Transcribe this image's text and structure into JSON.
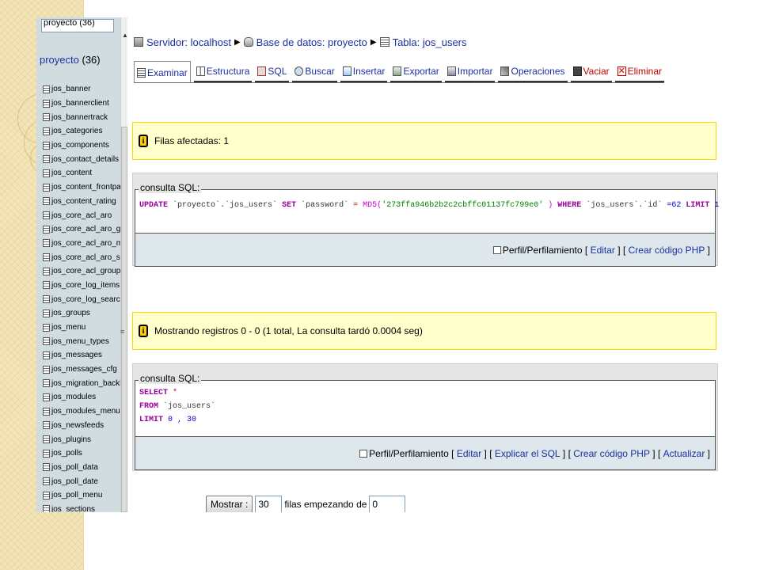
{
  "nav": {
    "db_select_text": "proyecto (36)",
    "db_title": {
      "name": "proyecto",
      "count": "(36)"
    },
    "tables": [
      "jos_banner",
      "jos_bannerclient",
      "jos_bannertrack",
      "jos_categories",
      "jos_components",
      "jos_contact_details",
      "jos_content",
      "jos_content_frontpage",
      "jos_content_rating",
      "jos_core_acl_aro",
      "jos_core_acl_aro_groups",
      "jos_core_acl_aro_map",
      "jos_core_acl_aro_sections",
      "jos_core_acl_groups_aro_m",
      "jos_core_log_items",
      "jos_core_log_searches",
      "jos_groups",
      "jos_menu",
      "jos_menu_types",
      "jos_messages",
      "jos_messages_cfg",
      "jos_migration_backlinks",
      "jos_modules",
      "jos_modules_menu",
      "jos_newsfeeds",
      "jos_plugins",
      "jos_polls",
      "jos_poll_data",
      "jos_poll_date",
      "jos_poll_menu",
      "jos_sections"
    ]
  },
  "breadcrumb": {
    "server": "Servidor: localhost",
    "database": "Base de datos: proyecto",
    "table": "Tabla: jos_users"
  },
  "tabs": [
    {
      "label": "Examinar",
      "icon": "browse-icon"
    },
    {
      "label": "Estructura",
      "icon": "structure-icon"
    },
    {
      "label": "SQL",
      "icon": "sql-icon"
    },
    {
      "label": "Buscar",
      "icon": "search-icon"
    },
    {
      "label": "Insertar",
      "icon": "insert-icon"
    },
    {
      "label": "Exportar",
      "icon": "export-icon"
    },
    {
      "label": "Importar",
      "icon": "import-icon"
    },
    {
      "label": "Operaciones",
      "icon": "operations-icon"
    },
    {
      "label": "Vaciar",
      "icon": "empty-icon"
    },
    {
      "label": "Eliminar",
      "icon": "drop-icon"
    }
  ],
  "notice1": {
    "text": "Filas afectadas:  1"
  },
  "sql1": {
    "legend": "consulta SQL:",
    "kw_update": "UPDATE",
    "db_table": "`proyecto`.`jos_users`",
    "kw_set": "SET",
    "col_password": "`password`",
    "eq": "=",
    "fn_md5": "MD5(",
    "hash": "'273ffa946b2b2c2cbffc01137fc799e0'",
    "close": ")",
    "kw_where": "WHERE",
    "col_id": "`jos_users`.`id`",
    "eq2": "=62",
    "kw_limit": "LIMIT",
    "limit_val": "1 ;",
    "footer": {
      "profiling": "Perfil/Perfilamiento",
      "edit": "Editar",
      "php": "Crear código PHP"
    }
  },
  "notice2": {
    "text": "Mostrando registros 0 - 0 (1 total, La consulta tardó 0.0004 seg)"
  },
  "sql2": {
    "legend": "consulta SQL:",
    "kw_select": "SELECT",
    "star": "*",
    "kw_from": "FROM",
    "table": "`jos_users`",
    "kw_limit": "LIMIT",
    "limit_val": "0 , 30",
    "footer": {
      "profiling": "Perfil/Perfilamiento",
      "edit": "Editar",
      "explain": "Explicar el SQL",
      "php": "Crear código PHP",
      "refresh": "Actualizar"
    }
  },
  "pager": {
    "show_button": "Mostrar :",
    "rows_value": "30",
    "rows_label": "filas empezando de",
    "start_value": "0"
  }
}
